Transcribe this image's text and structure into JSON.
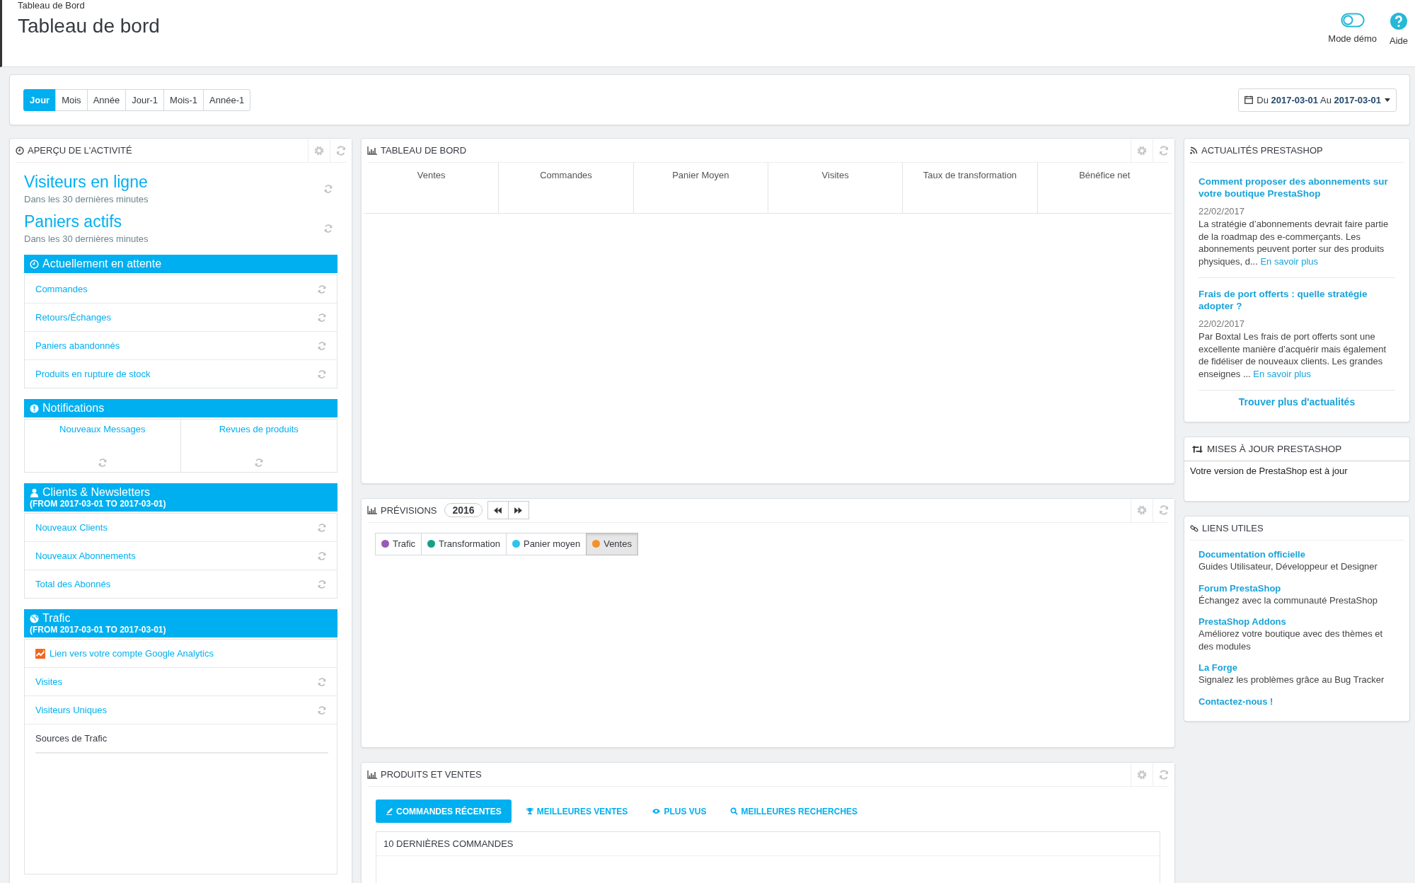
{
  "header": {
    "breadcrumb": "Tableau de Bord",
    "title": "Tableau de bord",
    "actions": [
      {
        "kind": "toggle",
        "label": "Mode démo"
      },
      {
        "kind": "help",
        "label": "Aide"
      }
    ]
  },
  "toolbar": {
    "periods": [
      {
        "label": "Jour",
        "selected": true
      },
      {
        "label": "Mois",
        "selected": false
      },
      {
        "label": "Année",
        "selected": false
      },
      {
        "label": "Jour-1",
        "selected": false
      },
      {
        "label": "Mois-1",
        "selected": false
      },
      {
        "label": "Année-1",
        "selected": false
      }
    ],
    "date_range": {
      "prefix": "Du",
      "from": "2017-03-01",
      "middle": "Au",
      "to": "2017-03-01"
    }
  },
  "activity": {
    "title": "APERÇU DE L'ACTIVITÉ",
    "metrics": [
      {
        "title": "Visiteurs en ligne",
        "subtitle": "Dans les 30 dernières minutes"
      },
      {
        "title": "Paniers actifs",
        "subtitle": "Dans les 30 dernières minutes"
      }
    ],
    "sections": [
      {
        "kind": "list",
        "title": "Actuellement en attente",
        "items": [
          {
            "kind": "link",
            "label": "Commandes"
          },
          {
            "kind": "link",
            "label": "Retours/Échanges"
          },
          {
            "kind": "link",
            "label": "Paniers abandonnés"
          },
          {
            "kind": "link",
            "label": "Produits en rupture de stock"
          }
        ]
      },
      {
        "kind": "grid",
        "title": "Notifications",
        "items": [
          {
            "label": "Nouveaux Messages"
          },
          {
            "label": "Revues de produits"
          }
        ]
      },
      {
        "kind": "list",
        "title": "Clients & Newsletters",
        "subtitle": "(FROM 2017-03-01 TO 2017-03-01)",
        "items": [
          {
            "kind": "link",
            "label": "Nouveaux Clients"
          },
          {
            "kind": "link",
            "label": "Nouveaux Abonnements"
          },
          {
            "kind": "link",
            "label": "Total des Abonnés"
          }
        ]
      },
      {
        "kind": "list",
        "title": "Trafic",
        "subtitle": "(FROM 2017-03-01 TO 2017-03-01)",
        "items": [
          {
            "kind": "analytics",
            "label": "Lien vers votre compte Google Analytics"
          },
          {
            "kind": "link",
            "label": "Visites"
          },
          {
            "kind": "link",
            "label": "Visiteurs Uniques"
          },
          {
            "kind": "heading",
            "label": "Sources de Trafic"
          }
        ]
      }
    ]
  },
  "dashboard": {
    "title": "TABLEAU DE BORD",
    "columns": [
      "Ventes",
      "Commandes",
      "Panier Moyen",
      "Visites",
      "Taux de transformation",
      "Bénéfice net"
    ]
  },
  "forecast": {
    "title": "PRÉVISIONS",
    "year": "2016",
    "legend": [
      {
        "label": "Trafic",
        "color": "#9b59b6",
        "selected": false
      },
      {
        "label": "Transformation",
        "color": "#16a085",
        "selected": false
      },
      {
        "label": "Panier moyen",
        "color": "#29c5f0",
        "selected": false
      },
      {
        "label": "Ventes",
        "color": "#f39229",
        "selected": true
      }
    ]
  },
  "products": {
    "title": "PRODUITS ET VENTES",
    "tabs": [
      {
        "label": "COMMANDES RÉCENTES",
        "selected": true
      },
      {
        "label": "MEILLEURES VENTES",
        "selected": false
      },
      {
        "label": "PLUS VUS",
        "selected": false
      },
      {
        "label": "MEILLEURES RECHERCHES",
        "selected": false
      }
    ],
    "table_title": "10 DERNIÈRES COMMANDES"
  },
  "news": {
    "title": "ACTUALITÉS PRESTASHOP",
    "articles": [
      {
        "title": "Comment proposer des abonnements sur votre boutique PrestaShop",
        "date": "22/02/2017",
        "text": "La stratégie d’abonnements devrait faire partie de la roadmap des e-commerçants. Les abonnements peuvent porter sur des produits physiques, d...",
        "more": "En savoir plus"
      },
      {
        "title": "Frais de port offerts : quelle stratégie adopter ?",
        "date": "22/02/2017",
        "text": "Par Boxtal Les frais de port offerts sont une excellente manière d’acquérir mais également de fidéliser de nouveaux clients. Les grandes enseignes ...",
        "more": "En savoir plus"
      }
    ],
    "more_link": "Trouver plus d'actualités"
  },
  "updates": {
    "title": "MISES À JOUR PRESTASHOP",
    "text": "Votre version de PrestaShop est à jour"
  },
  "links": {
    "title": "LIENS UTILES",
    "items": [
      {
        "title": "Documentation officielle",
        "description": "Guides Utilisateur, Développeur et Designer"
      },
      {
        "title": "Forum PrestaShop",
        "description": "Échangez avec la communauté PrestaShop"
      },
      {
        "title": "PrestaShop Addons",
        "description": "Améliorez votre boutique avec des thèmes et des modules"
      },
      {
        "title": "La Forge",
        "description": "Signalez les problèmes grâce au Bug Tracker"
      },
      {
        "title": "Contactez-nous !"
      }
    ]
  }
}
